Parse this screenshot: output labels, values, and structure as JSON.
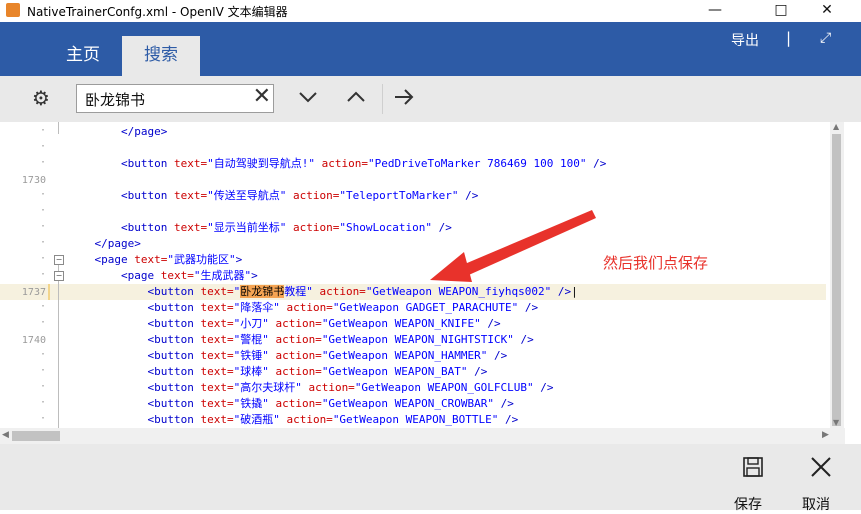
{
  "window": {
    "title": "NativeTrainerConfg.xml - OpenIV 文本编辑器",
    "icons": {
      "minimize": "minimize-icon",
      "maximize": "maximize-icon",
      "close": "close-icon"
    }
  },
  "ribbon": {
    "tabs": [
      {
        "label": "主页",
        "active": false
      },
      {
        "label": "搜索",
        "active": true
      }
    ],
    "export_label": "导出",
    "expand_icon": "expand-icon",
    "color": "#2d5ba6"
  },
  "search": {
    "value": "卧龙锦书",
    "icons": {
      "settings": "gear-icon",
      "clear": "clear-icon",
      "next": "chevron-down-icon",
      "prev": "chevron-up-icon",
      "go": "arrow-right-icon"
    }
  },
  "editor": {
    "line_numbers": [
      "1730",
      "1737",
      "1740"
    ],
    "lines": {
      "l0": [
        "        ",
        "</page>",
        "",
        "",
        ""
      ],
      "l2": [
        "        ",
        "<button ",
        "text=",
        "\"自动驾驶到导航点!\"",
        " action=",
        "\"PedDriveToMarker 786469 100 100\"",
        " />"
      ],
      "l4": [
        "        ",
        "<button ",
        "text=",
        "\"传送至导航点\"",
        " action=",
        "\"TeleportToMarker\"",
        " />"
      ],
      "l6": [
        "        ",
        "<button ",
        "text=",
        "\"显示当前坐标\"",
        " action=",
        "\"ShowLocation\"",
        " />"
      ],
      "l7": [
        "    ",
        "</page>",
        "",
        "",
        ""
      ],
      "l8": [
        "    ",
        "<page ",
        "text=",
        "\"武器功能区\"",
        ">",
        "",
        ""
      ],
      "l9": [
        "        ",
        "<page ",
        "text=",
        "\"生成武器\"",
        ">",
        "",
        ""
      ],
      "l10a": "            <button ",
      "l10b": "text=",
      "l10c": "\"",
      "l10hl": "卧龙锦书",
      "l10d": "教程\"",
      "l10e": " action=",
      "l10f": "\"GetWeapon WEAPON_fiyhqs002\"",
      "l10g": " />",
      "weapons": [
        {
          "text": "\"降落伞\"",
          "action": "\"GetWeapon GADGET_PARACHUTE\""
        },
        {
          "text": "\"小刀\"",
          "action": "\"GetWeapon WEAPON_KNIFE\""
        },
        {
          "text": "\"警棍\"",
          "action": "\"GetWeapon WEAPON_NIGHTSTICK\""
        },
        {
          "text": "\"铁锤\"",
          "action": "\"GetWeapon WEAPON_HAMMER\""
        },
        {
          "text": "\"球棒\"",
          "action": "\"GetWeapon WEAPON_BAT\""
        },
        {
          "text": "\"高尔夫球杆\"",
          "action": "\"GetWeapon WEAPON_GOLFCLUB\""
        },
        {
          "text": "\"铁撬\"",
          "action": "\"GetWeapon WEAPON_CROWBAR\""
        },
        {
          "text": "\"破酒瓶\"",
          "action": "\"GetWeapon WEAPON_BOTTLE\""
        }
      ],
      "btn_open": "            <button ",
      "text_attr": "text=",
      "action_attr": " action=",
      "close": " />"
    },
    "annotation": "然后我们点保存",
    "annotation_color": "#e8322b",
    "highlight_color": "#f5a453"
  },
  "footer": {
    "save_label": "保存",
    "cancel_label": "取消",
    "icons": {
      "save": "save-icon",
      "cancel": "cancel-x-icon"
    }
  }
}
